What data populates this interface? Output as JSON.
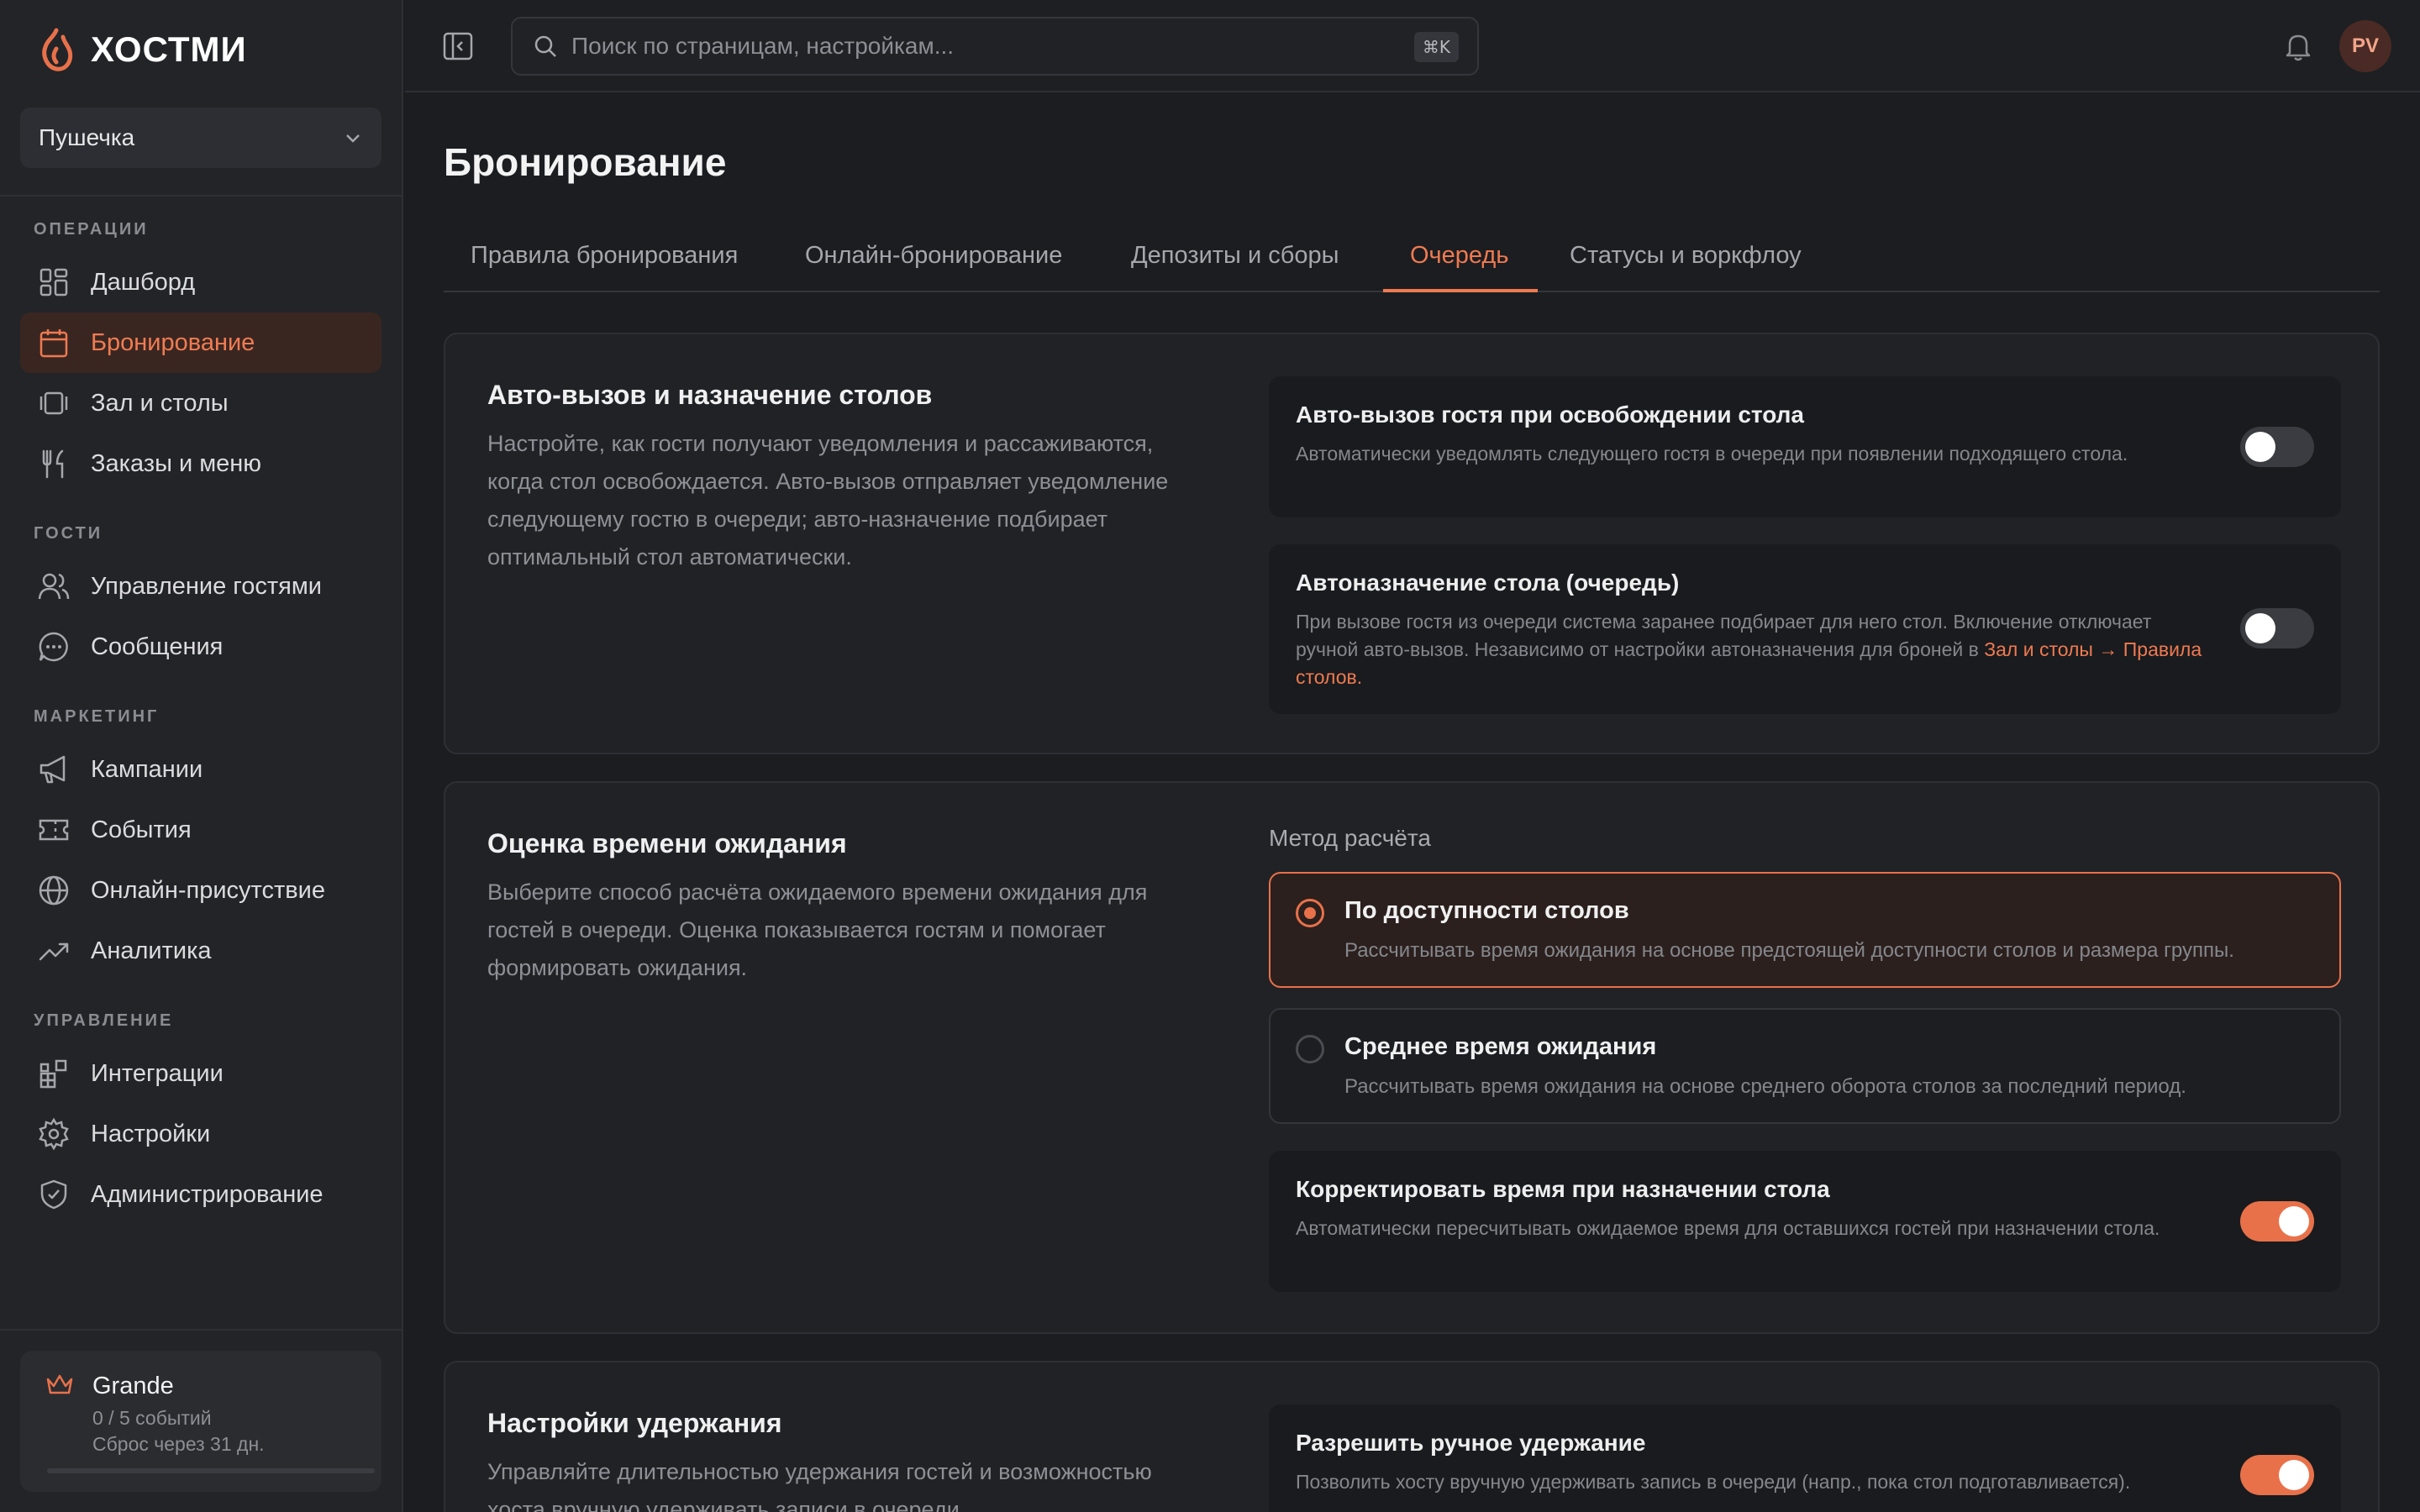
{
  "brand": {
    "name": "ХОСТМИ",
    "accent": "#e8714a"
  },
  "workspace": {
    "name": "Пушечка"
  },
  "sidebar": {
    "sections": [
      {
        "label": "ОПЕРАЦИИ",
        "items": [
          {
            "label": "Дашборд",
            "icon": "dashboard-icon"
          },
          {
            "label": "Бронирование",
            "icon": "calendar-icon",
            "active": true
          },
          {
            "label": "Зал и столы",
            "icon": "tables-icon"
          },
          {
            "label": "Заказы и меню",
            "icon": "utensils-icon"
          }
        ]
      },
      {
        "label": "ГОСТИ",
        "items": [
          {
            "label": "Управление гостями",
            "icon": "users-icon"
          },
          {
            "label": "Сообщения",
            "icon": "message-icon"
          }
        ]
      },
      {
        "label": "МАРКЕТИНГ",
        "items": [
          {
            "label": "Кампании",
            "icon": "megaphone-icon"
          },
          {
            "label": "События",
            "icon": "ticket-icon"
          },
          {
            "label": "Онлайн-присутствие",
            "icon": "globe-icon"
          },
          {
            "label": "Аналитика",
            "icon": "trend-icon"
          }
        ]
      },
      {
        "label": "УПРАВЛЕНИЕ",
        "items": [
          {
            "label": "Интеграции",
            "icon": "blocks-icon"
          },
          {
            "label": "Настройки",
            "icon": "gear-icon"
          },
          {
            "label": "Администрирование",
            "icon": "shield-icon"
          }
        ]
      }
    ],
    "plan": {
      "name": "Grande",
      "usage": "0 / 5 событий",
      "reset": "Сброс через 31 дн.",
      "progress": 0
    }
  },
  "topbar": {
    "search_placeholder": "Поиск по страницам, настройкам...",
    "shortcut": "⌘K",
    "avatar_initials": "PV"
  },
  "page": {
    "title": "Бронирование",
    "tabs": [
      {
        "label": "Правила бронирования"
      },
      {
        "label": "Онлайн-бронирование"
      },
      {
        "label": "Депозиты и сборы"
      },
      {
        "label": "Очередь",
        "active": true
      },
      {
        "label": "Статусы и воркфлоу"
      }
    ]
  },
  "cards": {
    "autocall": {
      "title": "Авто-вызов и назначение столов",
      "desc": "Настройте, как гости получают уведомления и рассаживаются, когда стол освобождается. Авто-вызов отправляет уведомление следующему гостю в очереди; авто-назначение подбирает оптимальный стол автоматически.",
      "settings": [
        {
          "title": "Авто-вызов гостя при освобождении стола",
          "desc": "Автоматически уведомлять следующего гостя в очереди при появлении подходящего стола.",
          "on": false
        },
        {
          "title": "Автоназначение стола (очередь)",
          "desc": "При вызове гостя из очереди система заранее подбирает для него стол. Включение отключает ручной авто-вызов. Независимо от настройки автоназначения для броней в ",
          "link": "Зал и столы → Правила столов.",
          "on": false
        }
      ]
    },
    "wait": {
      "title": "Оценка времени ожидания",
      "desc": "Выберите способ расчёта ожидаемого времени ожидания для гостей в очереди. Оценка показывается гостям и помогает формировать ожидания.",
      "method_label": "Метод расчёта",
      "options": [
        {
          "title": "По доступности столов",
          "desc": "Рассчитывать время ожидания на основе предстоящей доступности столов и размера группы.",
          "selected": true
        },
        {
          "title": "Среднее время ожидания",
          "desc": "Рассчитывать время ожидания на основе среднего оборота столов за последний период.",
          "selected": false
        }
      ],
      "adjust": {
        "title": "Корректировать время при назначении стола",
        "desc": "Автоматически пересчитывать ожидаемое время для оставшихся гостей при назначении стола.",
        "on": true
      }
    },
    "hold": {
      "title": "Настройки удержания",
      "desc": "Управляйте длительностью удержания гостей и возможностью хоста вручную удерживать записи в очереди.",
      "manual": {
        "title": "Разрешить ручное удержание",
        "desc": "Позволить хосту вручную удерживать запись в очереди (напр., пока стол подготавливается).",
        "on": true
      }
    }
  }
}
